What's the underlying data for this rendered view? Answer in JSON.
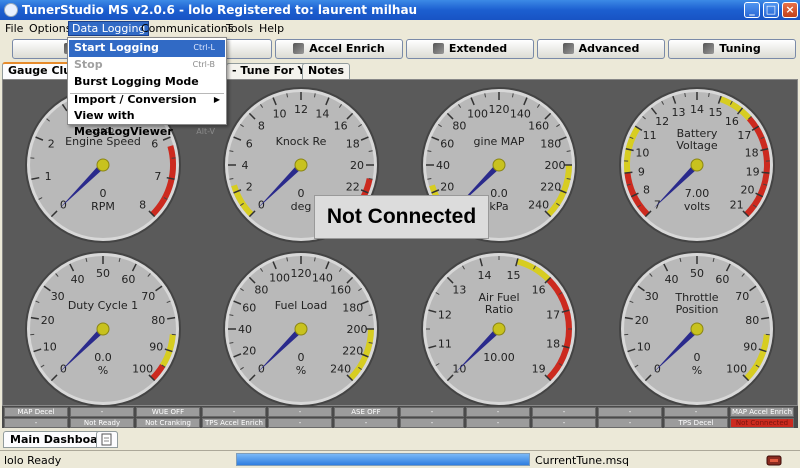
{
  "window": {
    "title": "TunerStudio MS v2.0.6 - lolo Registered to: laurent milhau",
    "controls": [
      "_",
      "□",
      "×"
    ]
  },
  "menubar": [
    "File",
    "Options",
    "Data Logging",
    "Communications",
    "Tools",
    "Help"
  ],
  "toolbar": [
    {
      "label": "B",
      "icon": "basic-icon"
    },
    {
      "label": "dle",
      "icon": "idle-icon"
    },
    {
      "label": "Accel Enrich",
      "icon": "wrench-icon"
    },
    {
      "label": "Extended",
      "icon": "hammer-icon"
    },
    {
      "label": "Advanced",
      "icon": "advanced-icon"
    },
    {
      "label": "Tuning",
      "icon": "tuning-icon"
    }
  ],
  "tabs": [
    "Gauge Cluster",
    "- Tune For You",
    "Notes"
  ],
  "data_logging_menu": [
    {
      "label": "Start Logging",
      "accel": "Ctrl-L"
    },
    {
      "label": "Stop",
      "accel": "Ctrl-B"
    },
    {
      "label": "Burst Logging Mode",
      "accel": ""
    },
    {
      "label": "Import / Conversion",
      "accel": ""
    },
    {
      "label": "View with MegaLogViewer",
      "accel": "Alt-V"
    }
  ],
  "overlay": "Not Connected",
  "gauges": [
    {
      "title": [
        "Engine Speed"
      ],
      "multiplier": "x1000",
      "units": "RPM",
      "value": "0",
      "ticks": [
        "0",
        "1",
        "2",
        "3",
        "4",
        "5",
        "6",
        "7",
        "8"
      ],
      "zones": [
        {
          "from": 6.2,
          "to": 8,
          "color": "#cc2a1f"
        }
      ],
      "needle": 0
    },
    {
      "title": [
        "Knock Re"
      ],
      "multiplier": "",
      "units": "deg",
      "value": "0",
      "ticks": [
        "0",
        "2",
        "4",
        "6",
        "8",
        "10",
        "12",
        "14",
        "16",
        "18",
        "20",
        "22",
        "24"
      ],
      "zones": [
        {
          "from": 0,
          "to": 2.5,
          "color": "#d7cd21"
        },
        {
          "from": 21,
          "to": 24,
          "color": "#cc2a1f"
        }
      ],
      "needle": 0
    },
    {
      "title": [
        "gine MAP"
      ],
      "multiplier": "",
      "units": "kPa",
      "value": "0.0",
      "ticks": [
        "0",
        "20",
        "40",
        "60",
        "80",
        "100",
        "120",
        "140",
        "160",
        "180",
        "200",
        "220",
        "240"
      ],
      "zones": [
        {
          "from": 0,
          "to": 25,
          "color": "#d7cd21"
        },
        {
          "from": 200,
          "to": 240,
          "color": "#d7cd21"
        }
      ],
      "needle": 0
    },
    {
      "title": [
        "Battery",
        "Voltage"
      ],
      "multiplier": "",
      "units": "volts",
      "value": "7.00",
      "ticks": [
        "7",
        "8",
        "9",
        "10",
        "11",
        "12",
        "13",
        "14",
        "15",
        "16",
        "17",
        "18",
        "19",
        "20",
        "21"
      ],
      "zones": [
        {
          "from": 7,
          "to": 9,
          "color": "#cc2a1f"
        },
        {
          "from": 9,
          "to": 11,
          "color": "#d7cd21"
        },
        {
          "from": 15,
          "to": 16.5,
          "color": "#d7cd21"
        },
        {
          "from": 16.5,
          "to": 21,
          "color": "#cc2a1f"
        }
      ],
      "needle": 7
    },
    {
      "title": [
        "Duty Cycle 1"
      ],
      "multiplier": "",
      "units": "%",
      "value": "0.0",
      "ticks": [
        "0",
        "10",
        "20",
        "30",
        "40",
        "50",
        "60",
        "70",
        "80",
        "90",
        "100"
      ],
      "zones": [
        {
          "from": 85,
          "to": 95,
          "color": "#d7cd21"
        },
        {
          "from": 95,
          "to": 100,
          "color": "#cc2a1f"
        }
      ],
      "needle": 0
    },
    {
      "title": [
        "Fuel Load"
      ],
      "multiplier": "",
      "units": "%",
      "value": "0",
      "ticks": [
        "0",
        "20",
        "40",
        "60",
        "80",
        "100",
        "120",
        "140",
        "160",
        "180",
        "200",
        "220",
        "240"
      ],
      "zones": [
        {
          "from": 200,
          "to": 240,
          "color": "#d7cd21"
        }
      ],
      "needle": 0
    },
    {
      "title": [
        "Air Fuel",
        "Ratio"
      ],
      "multiplier": "",
      "units": "",
      "value": "10.00",
      "ticks": [
        "10",
        "11",
        "12",
        "13",
        "14",
        "15",
        "16",
        "17",
        "18",
        "19"
      ],
      "zones": [
        {
          "from": 15,
          "to": 16,
          "color": "#d7cd21"
        },
        {
          "from": 16,
          "to": 19,
          "color": "#cc2a1f"
        }
      ],
      "needle": 10
    },
    {
      "title": [
        "Throttle",
        "Position"
      ],
      "multiplier": "",
      "units": "%",
      "value": "0",
      "ticks": [
        "0",
        "10",
        "20",
        "30",
        "40",
        "50",
        "60",
        "70",
        "80",
        "90",
        "100"
      ],
      "zones": [
        {
          "from": 85,
          "to": 100,
          "color": "#d7cd21"
        }
      ],
      "needle": 0
    }
  ],
  "indicators": [
    [
      {
        "label": "MAP Decel",
        "state": "off"
      },
      {
        "label": "-",
        "state": "off"
      },
      {
        "label": "WUE OFF",
        "state": "off"
      },
      {
        "label": "-",
        "state": "off"
      },
      {
        "label": "-",
        "state": "off"
      },
      {
        "label": "ASE OFF",
        "state": "off"
      },
      {
        "label": "-",
        "state": "off"
      },
      {
        "label": "-",
        "state": "off"
      },
      {
        "label": "-",
        "state": "off"
      },
      {
        "label": "-",
        "state": "off"
      },
      {
        "label": "-",
        "state": "off"
      },
      {
        "label": "MAP Accel Enrich",
        "state": "off"
      }
    ],
    [
      {
        "label": "-",
        "state": "off"
      },
      {
        "label": "Not Ready",
        "state": "off"
      },
      {
        "label": "Not Cranking",
        "state": "off"
      },
      {
        "label": "TPS Accel Enrich",
        "state": "off"
      },
      {
        "label": "-",
        "state": "off"
      },
      {
        "label": "-",
        "state": "off"
      },
      {
        "label": "-",
        "state": "off"
      },
      {
        "label": "-",
        "state": "off"
      },
      {
        "label": "-",
        "state": "off"
      },
      {
        "label": "-",
        "state": "off"
      },
      {
        "label": "TPS Decel",
        "state": "off"
      },
      {
        "label": "Not Connected",
        "state": "alert"
      }
    ]
  ],
  "bottom_tabs": [
    "Main Dashboard"
  ],
  "status": {
    "left": "lolo Ready",
    "file": "CurrentTune.msq",
    "progress": 1.0
  },
  "colors": {
    "dashboard_bg": "#5a5a5a",
    "gauge_face": "#b9b9b9",
    "needle": "#2a2a8c",
    "warning": "#d7cd21",
    "danger": "#cc2a1f",
    "selection": "#316ac5"
  }
}
